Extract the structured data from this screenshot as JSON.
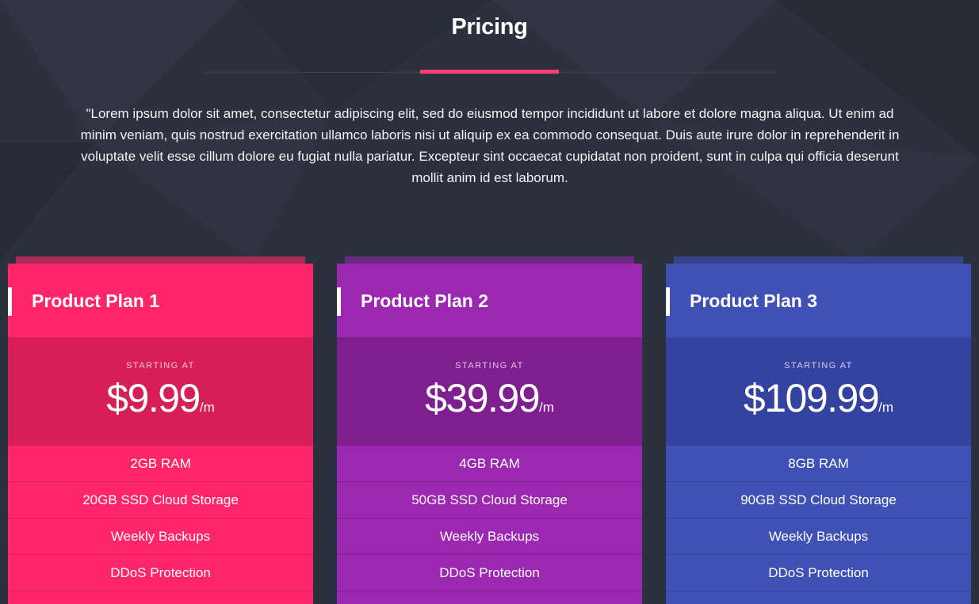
{
  "header": {
    "title": "Pricing",
    "intro": "\"Lorem ipsum dolor sit amet, consectetur adipiscing elit, sed do eiusmod tempor incididunt ut labore et dolore magna aliqua. Ut enim ad minim veniam, quis nostrud exercitation ullamco laboris nisi ut aliquip ex ea commodo consequat. Duis aute irure dolor in reprehenderit in voluptate velit esse cillum dolore eu fugiat nulla pariatur. Excepteur sint occaecat cupidatat non proident, sunt in culpa qui officia deserunt mollit anim id est laborum.",
    "accent_color": "#ff3d74"
  },
  "plans": [
    {
      "name": "Product Plan 1",
      "starting_label": "STARTING AT",
      "price": "$9.99",
      "period": "/m",
      "features": [
        "2GB RAM",
        "20GB SSD Cloud Storage",
        "Weekly Backups",
        "DDoS Protection"
      ],
      "colors": {
        "main": "#ff256b",
        "price_bg": "#d61f56",
        "tab": "#b02a57"
      }
    },
    {
      "name": "Product Plan 2",
      "starting_label": "STARTING AT",
      "price": "$39.99",
      "period": "/m",
      "features": [
        "4GB RAM",
        "50GB SSD Cloud Storage",
        "Weekly Backups",
        "DDoS Protection"
      ],
      "colors": {
        "main": "#9c27b0",
        "price_bg": "#7f1f8f",
        "tab": "#6a2a80"
      }
    },
    {
      "name": "Product Plan 3",
      "starting_label": "STARTING AT",
      "price": "$109.99",
      "period": "/m",
      "features": [
        "8GB RAM",
        "90GB SSD Cloud Storage",
        "Weekly Backups",
        "DDoS Protection"
      ],
      "colors": {
        "main": "#3f51b5",
        "price_bg": "#3443a0",
        "tab": "#36448a"
      }
    }
  ],
  "colors": {
    "page_bg": "#2b313d"
  }
}
